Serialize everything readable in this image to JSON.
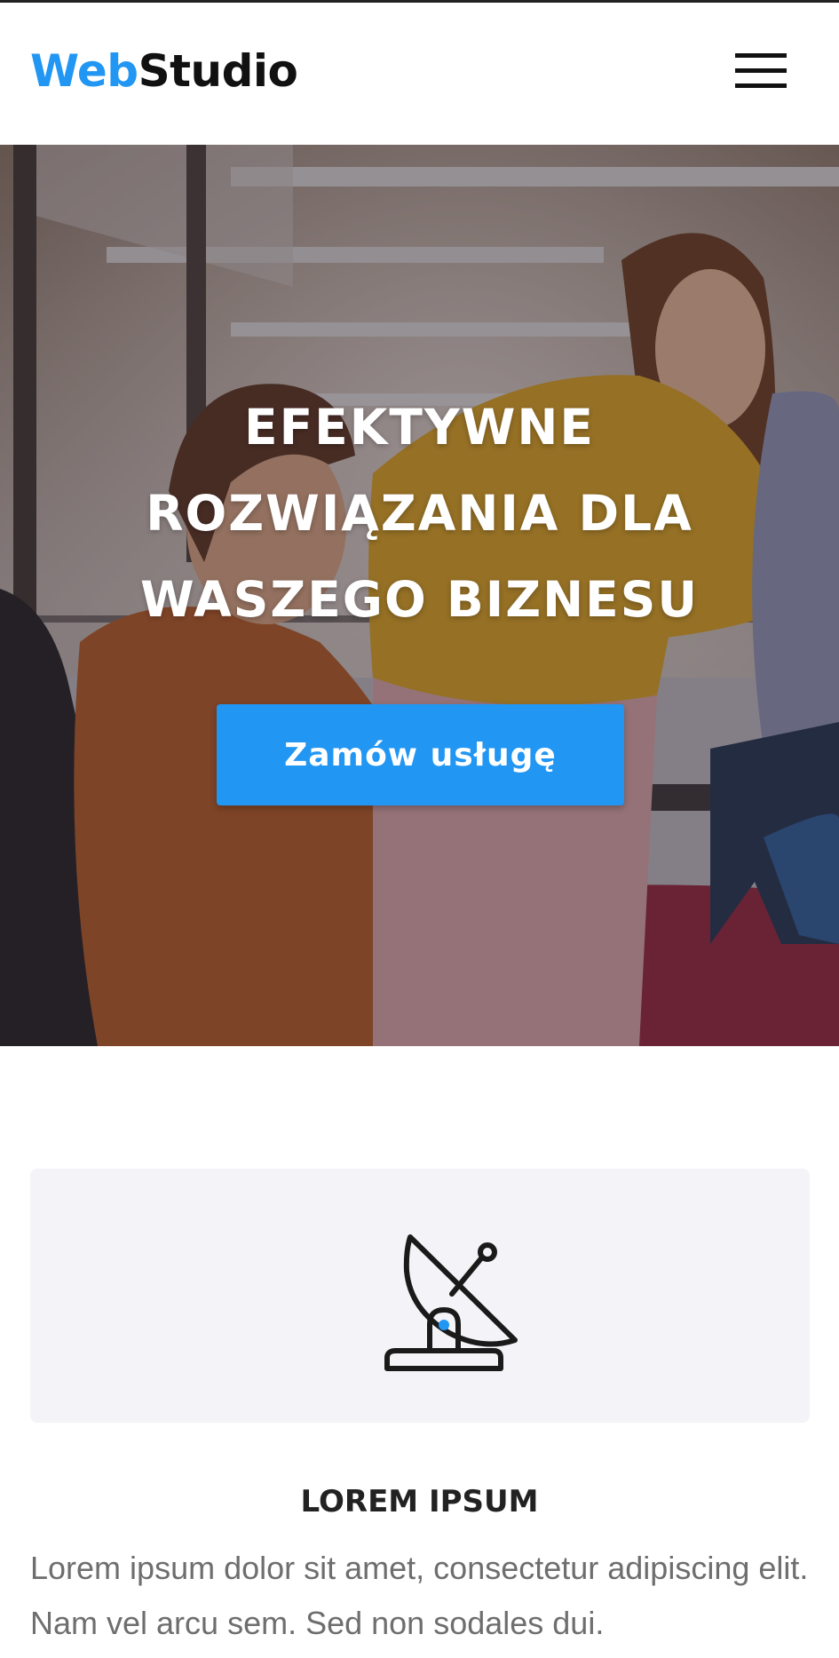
{
  "header": {
    "logo_part1": "Web",
    "logo_part2": "Studio",
    "menu_icon": "hamburger-menu-icon"
  },
  "hero": {
    "title_lines": [
      "EFEKTYWNE",
      "ROZWIĄZANIA DLA",
      "WASZEGO BIZNESU"
    ],
    "cta_label": "Zamów usługę"
  },
  "feature": {
    "icon": "satellite-dish-icon",
    "title": "LOREM IPSUM",
    "text": "Lorem ipsum dolor sit amet, consectetur adipiscing elit. Nam vel arcu sem. Sed non sodales dui."
  },
  "colors": {
    "accent": "#2196f3",
    "dark": "#111111",
    "card_bg": "#f3f3f8",
    "body_text": "#6e6e6e"
  }
}
